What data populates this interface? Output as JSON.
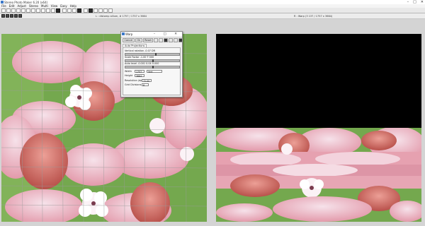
{
  "window": {
    "title": "Stereo Photo Maker 6.20 (x64)",
    "controls": [
      "–",
      "□",
      "✕"
    ]
  },
  "menu": [
    "File",
    "Edit",
    "Adjust",
    "Stereo",
    "Multi",
    "View",
    "Easy",
    "Help"
  ],
  "panel_labels": {
    "left": "L : distomp allium, # 1757 / 1757 x 3664",
    "right": "R : Warp (3 137 / 1757 x 3664)"
  },
  "dialog": {
    "title": "Warp",
    "controls": "–  □  ✕",
    "buttons": [
      "Cancel",
      "Ok",
      "Reset"
    ],
    "tab": "Auto Projections",
    "rows": {
      "row1": "Vertical rotation  -0.07 DR",
      "row2": "Scale Factor  -1.00 T 000",
      "row3": "Auto level  -0.001 0.04 0.000",
      "width_label": "Width",
      "width_value": "1757",
      "mode_value": "Vert",
      "height_label": "Height",
      "height_value": "3664",
      "resolution_label": "Resolution (dpi)",
      "resolution_value": "72.00",
      "grid_label": "Grid Divisions",
      "grid_value": "8"
    },
    "slider_levels": [
      0.55,
      0.5,
      0.5
    ]
  },
  "icons": {
    "app": "app-icon",
    "toolbar": "toolbar-icon"
  },
  "colors": {
    "petal_pink": "#e9a7b3",
    "petal_white": "#f7e9ef",
    "leaf_green": "#6aa24a",
    "bud_red": "#c55a55"
  }
}
